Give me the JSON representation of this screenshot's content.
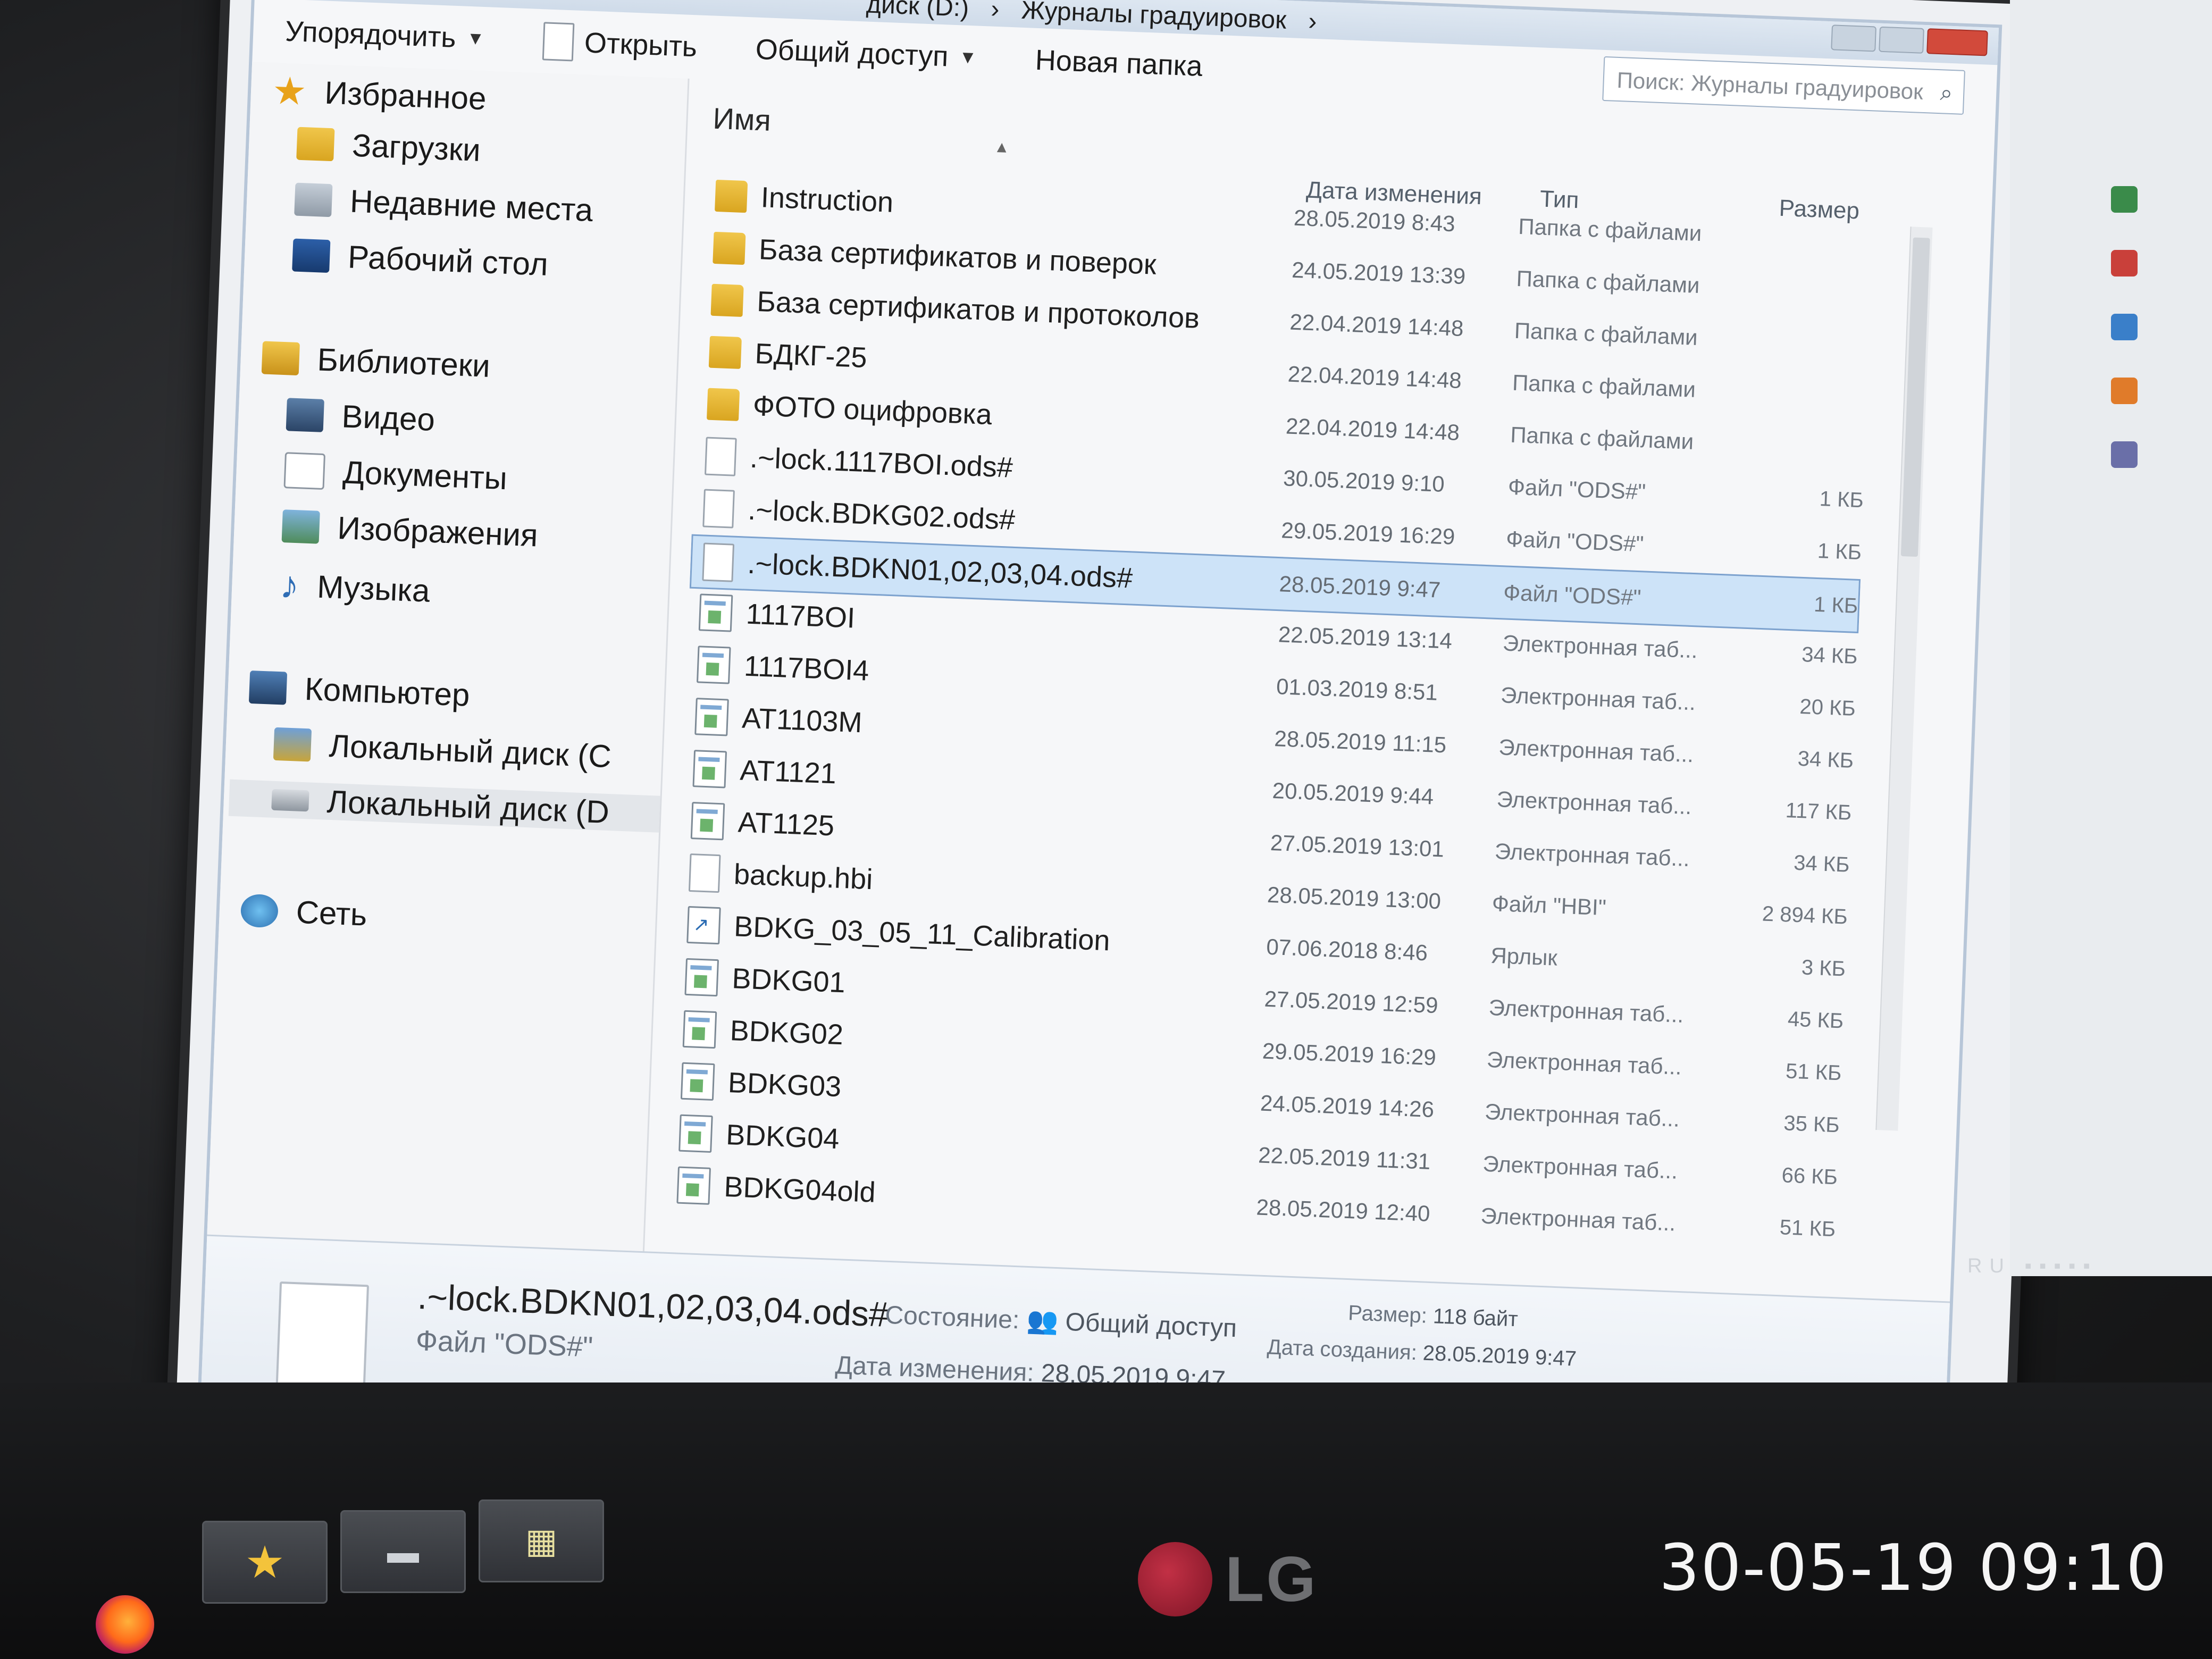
{
  "window": {
    "breadcrumb": [
      "диск (D:)",
      "›",
      "Журналы градуировок",
      "›"
    ],
    "search_placeholder": "Поиск: Журналы градуировок"
  },
  "toolbar": {
    "organize": "Упорядочить",
    "open": "Открыть",
    "share": "Общий доступ",
    "new_folder": "Новая папка"
  },
  "nav": {
    "favorites": "Избранное",
    "downloads": "Загрузки",
    "recent": "Недавние места",
    "desktop": "Рабочий стол",
    "libraries": "Библиотеки",
    "video": "Видео",
    "documents": "Документы",
    "images": "Изображения",
    "music": "Музыка",
    "computer": "Компьютер",
    "disk_c": "Локальный диск (C",
    "disk_d": "Локальный диск (D",
    "network": "Сеть"
  },
  "columns": {
    "name": "Имя",
    "date": "Дата изменения",
    "type": "Тип",
    "size": "Размер"
  },
  "files": [
    {
      "name": "Instruction",
      "date": "28.05.2019 8:43",
      "type": "Папка с файлами",
      "size": "",
      "icon": "folder"
    },
    {
      "name": "База сертификатов и поверок",
      "date": "24.05.2019 13:39",
      "type": "Папка с файлами",
      "size": "",
      "icon": "folder"
    },
    {
      "name": "База сертификатов и протоколов",
      "date": "22.04.2019 14:48",
      "type": "Папка с файлами",
      "size": "",
      "icon": "folder"
    },
    {
      "name": "БДКГ-25",
      "date": "22.04.2019 14:48",
      "type": "Папка с файлами",
      "size": "",
      "icon": "folder"
    },
    {
      "name": "ФОТО оцифровка",
      "date": "22.04.2019 14:48",
      "type": "Папка с файлами",
      "size": "",
      "icon": "folder"
    },
    {
      "name": ".~lock.1117BOI.ods#",
      "date": "30.05.2019 9:10",
      "type": "Файл \"ODS#\"",
      "size": "1 КБ",
      "icon": "doc"
    },
    {
      "name": ".~lock.BDKG02.ods#",
      "date": "29.05.2019 16:29",
      "type": "Файл \"ODS#\"",
      "size": "1 КБ",
      "icon": "doc"
    },
    {
      "name": ".~lock.BDKN01,02,03,04.ods#",
      "date": "28.05.2019 9:47",
      "type": "Файл \"ODS#\"",
      "size": "1 КБ",
      "icon": "doc",
      "selected": true
    },
    {
      "name": "1117BOI",
      "date": "22.05.2019 13:14",
      "type": "Электронная таб...",
      "size": "34 КБ",
      "icon": "sheet"
    },
    {
      "name": "1117BOI4",
      "date": "01.03.2019 8:51",
      "type": "Электронная таб...",
      "size": "20 КБ",
      "icon": "sheet"
    },
    {
      "name": "AT1103M",
      "date": "28.05.2019 11:15",
      "type": "Электронная таб...",
      "size": "34 КБ",
      "icon": "sheet"
    },
    {
      "name": "AT1121",
      "date": "20.05.2019 9:44",
      "type": "Электронная таб...",
      "size": "117 КБ",
      "icon": "sheet"
    },
    {
      "name": "AT1125",
      "date": "27.05.2019 13:01",
      "type": "Электронная таб...",
      "size": "34 КБ",
      "icon": "sheet"
    },
    {
      "name": "backup.hbi",
      "date": "28.05.2019 13:00",
      "type": "Файл \"HBI\"",
      "size": "2 894 КБ",
      "icon": "doc"
    },
    {
      "name": "BDKG_03_05_11_Calibration",
      "date": "07.06.2018 8:46",
      "type": "Ярлык",
      "size": "3 КБ",
      "icon": "link"
    },
    {
      "name": "BDKG01",
      "date": "27.05.2019 12:59",
      "type": "Электронная таб...",
      "size": "45 КБ",
      "icon": "sheet"
    },
    {
      "name": "BDKG02",
      "date": "29.05.2019 16:29",
      "type": "Электронная таб...",
      "size": "51 КБ",
      "icon": "sheet"
    },
    {
      "name": "BDKG03",
      "date": "24.05.2019 14:26",
      "type": "Электронная таб...",
      "size": "35 КБ",
      "icon": "sheet"
    },
    {
      "name": "BDKG04",
      "date": "22.05.2019 11:31",
      "type": "Электронная таб...",
      "size": "66 КБ",
      "icon": "sheet"
    },
    {
      "name": "BDKG04old",
      "date": "28.05.2019 12:40",
      "type": "Электронная таб...",
      "size": "51 КБ",
      "icon": "sheet"
    }
  ],
  "details": {
    "name": ".~lock.BDKN01,02,03,04.ods#",
    "type": "Файл \"ODS#\"",
    "state_label": "Состояние:",
    "state_value": "Общий доступ",
    "modified_label": "Дата изменения:",
    "modified_value": "28.05.2019 9:47",
    "size_label": "Размер:",
    "size_value": "118 байт",
    "created_label": "Дата создания:",
    "created_value": "28.05.2019 9:47"
  },
  "tray": {
    "lang": "RU"
  },
  "monitor": {
    "brand": "LG"
  },
  "timestamp": "30-05-19 09:10",
  "colors": {
    "selection": "#cde3f8",
    "folder": "#e3b530"
  }
}
